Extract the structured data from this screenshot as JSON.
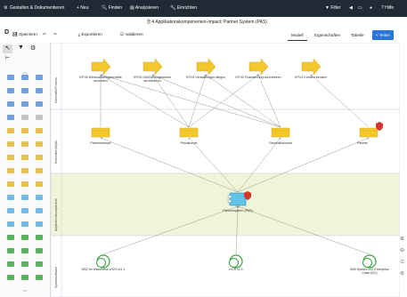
{
  "topbar": {
    "menu_gestalten": "Gestalten & Dokumentieren",
    "menu_neu": "+ Neu",
    "menu_finden": "Finden",
    "menu_analysieren": "Analysieren",
    "menu_einrichten": "Einrichten",
    "filter": "Filter",
    "hilfe": "Hilfe"
  },
  "title": "4 Applikationskomponenten-Impact: Partner System (PAS)",
  "toolbar": {
    "speichern": "Speichern",
    "exportieren": "Exportieren",
    "validieren": "Validieren",
    "tab_modell": "Modell",
    "tab_eigenschaften": "Eigenschaften",
    "tab_tabelle": "Tabelle",
    "tab_teilen": "Teilen"
  },
  "bands": {
    "business_process": "Geschäfts-Prozess",
    "business_object": "Geschäfts-Objekt",
    "application": "Applikationskomponente",
    "system_software": "Systemsoftware"
  },
  "processes": [
    "KP.05 Wertzuwachsgeschäfte anmelden",
    "KP.03 Gilt/Zahlungswesen durchführen",
    "KP.04 Verwaltungen tätigen",
    "KP.02 Finanzierung durchführen",
    "KP.01 Kunden beraten"
  ],
  "objects": [
    "Partnerstrasse",
    "Privatkunde",
    "Geschäftskunde",
    "Partner"
  ],
  "application": "Partnersystem (PAS)",
  "system_software": [
    "DB2 for Mainframe z/OS v11.1",
    "z/OS v1.1",
    "IBM System z12 Enterprise Class (EC)"
  ],
  "colors": {
    "topbar": "#1f2a35",
    "process_band": "#ffffff",
    "app_band": "#f2f4d8",
    "arrow": "#f4c82c",
    "object": "#f4c82c",
    "app": "#5fc3e6",
    "node": "#3aa640",
    "accent": "#2b74d9",
    "warning": "#d9322b"
  },
  "icons": [
    "gear-icon",
    "plus-icon",
    "search-icon",
    "chart-icon",
    "wrench-icon",
    "filter-icon",
    "back-icon",
    "user-icon",
    "help-icon",
    "save-icon",
    "undo-icon",
    "redo-icon",
    "export-icon",
    "validate-icon",
    "share-icon",
    "pointer-icon",
    "funnel-icon",
    "settings-icon"
  ]
}
